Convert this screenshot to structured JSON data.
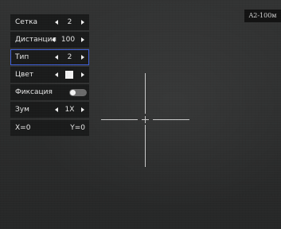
{
  "range_indicator": "A2-100м",
  "menu": {
    "items": [
      {
        "label": "Сетка",
        "value": "2"
      },
      {
        "label": "Дистанция",
        "value": "100"
      },
      {
        "label": "Тип",
        "value": "2"
      },
      {
        "label": "Цвет",
        "value": "",
        "swatch_color": "#f2f2f2"
      },
      {
        "label": "Фиксация",
        "toggle_on": false
      },
      {
        "label": "Зум",
        "value": "1X"
      }
    ],
    "selected_item": "Тип",
    "coords": {
      "x": "X=0",
      "y": "Y=0"
    }
  },
  "icons": [
    "chevron-left-icon",
    "chevron-right-icon",
    "crosshair-reticle"
  ],
  "colors": {
    "menu_bg": "#1a1b1b",
    "selection_outline": "#3f5fd9",
    "reticle": "#c9c9c9",
    "toggle_track": "#6a6a6a"
  }
}
